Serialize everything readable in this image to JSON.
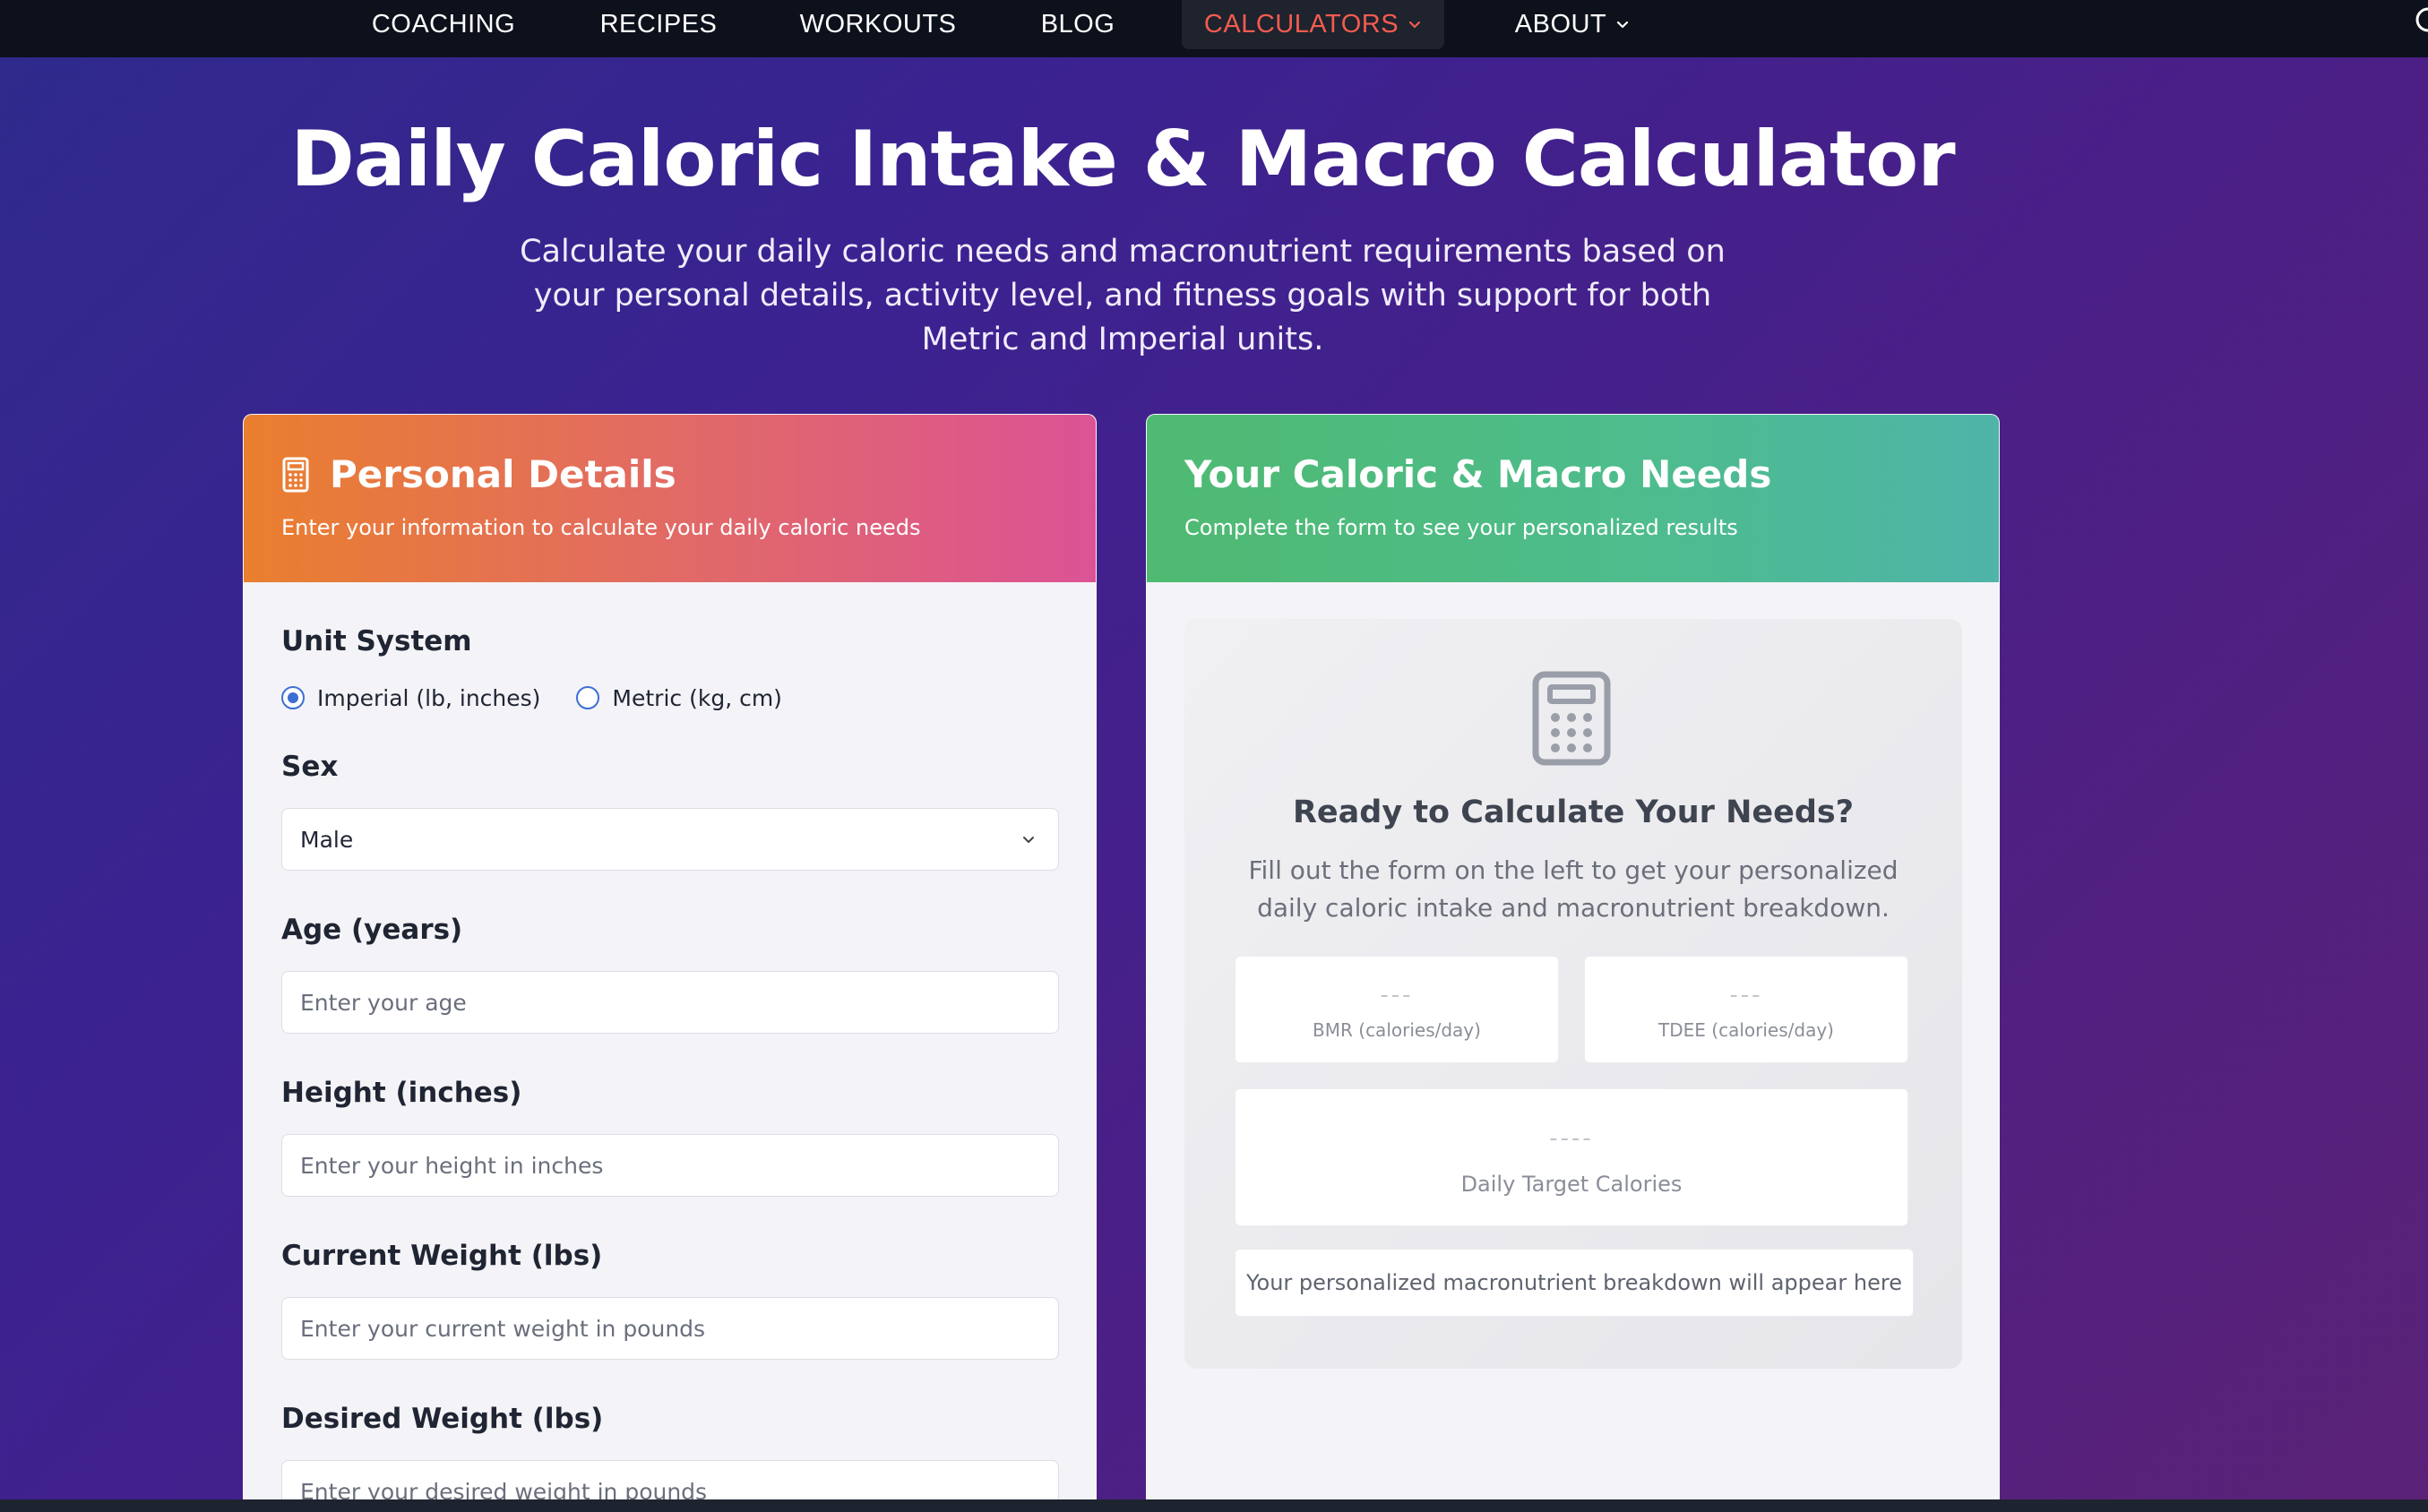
{
  "nav": {
    "items": [
      {
        "label": "COACHING"
      },
      {
        "label": "RECIPES"
      },
      {
        "label": "WORKOUTS"
      },
      {
        "label": "BLOG"
      },
      {
        "label": "CALCULATORS",
        "active": true
      },
      {
        "label": "ABOUT"
      }
    ]
  },
  "hero": {
    "title": "Daily Caloric Intake & Macro Calculator",
    "subtitle": "Calculate your daily caloric needs and macronutrient requirements based on your personal details, activity level, and fitness goals with support for both Metric and Imperial units."
  },
  "personal": {
    "title": "Personal Details",
    "description": "Enter your information to calculate your daily caloric needs",
    "unit_label": "Unit System",
    "unit_options": [
      "Imperial (lb, inches)",
      "Metric (kg, cm)"
    ],
    "unit_selected": "Imperial (lb, inches)",
    "sex_label": "Sex",
    "sex_value": "Male",
    "age_label": "Age (years)",
    "age_placeholder": "Enter your age",
    "height_label": "Height (inches)",
    "height_placeholder": "Enter your height in inches",
    "current_weight_label": "Current Weight (lbs)",
    "current_weight_placeholder": "Enter your current weight in pounds",
    "desired_weight_label": "Desired Weight (lbs)",
    "desired_weight_placeholder": "Enter your desired weight in pounds"
  },
  "results": {
    "title": "Your Caloric & Macro Needs",
    "description": "Complete the form to see your personalized results",
    "ready_title": "Ready to Calculate Your Needs?",
    "ready_text": "Fill out the form on the left to get your personalized daily caloric intake and macronutrient breakdown.",
    "bmr_value": "---",
    "bmr_label": "BMR (calories/day)",
    "tdee_value": "---",
    "tdee_label": "TDEE (calories/day)",
    "target_value": "----",
    "target_label": "Daily Target Calories",
    "macro_note": "Your personalized macronutrient breakdown will appear here"
  },
  "colors": {
    "nav_bg": "#0d111b",
    "nav_active": "#f45b4f",
    "accent_blue": "#3c6fd4"
  },
  "icons": [
    "chevron-down-icon",
    "calculator-icon"
  ]
}
